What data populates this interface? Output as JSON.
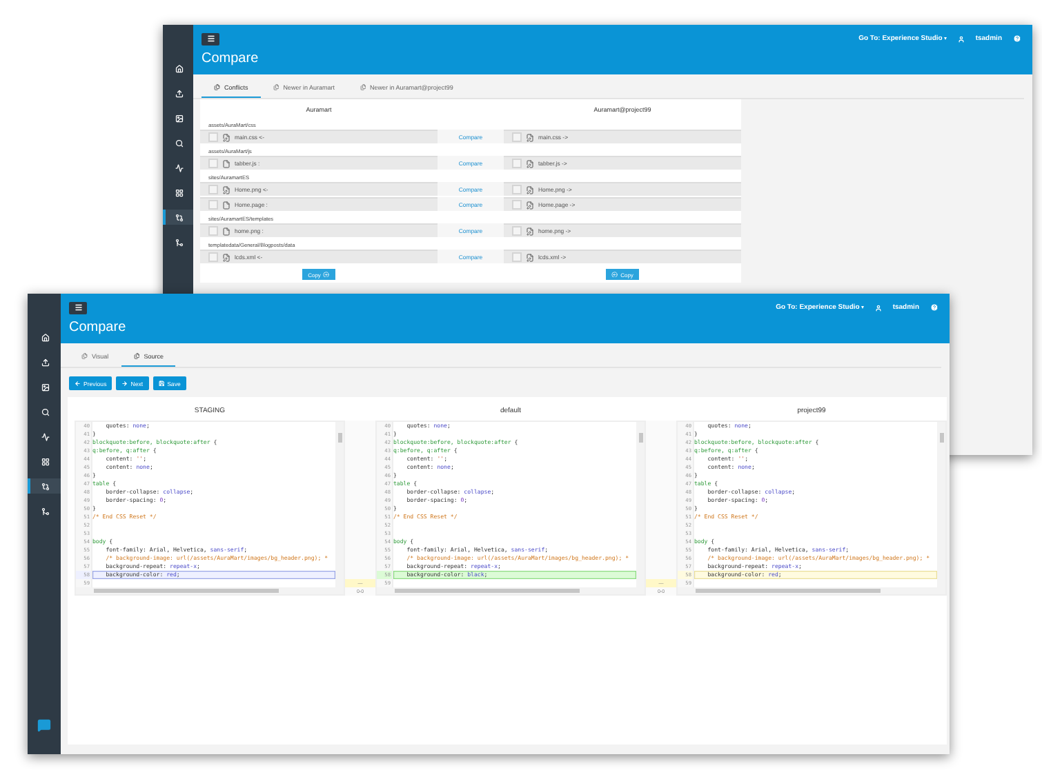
{
  "back_window": {
    "sidebar": [
      {
        "kind": "home",
        "selected": false
      },
      {
        "kind": "upload",
        "selected": false
      },
      {
        "kind": "image",
        "selected": false
      },
      {
        "kind": "search",
        "selected": false
      },
      {
        "kind": "activity",
        "selected": false
      },
      {
        "kind": "grid",
        "selected": false
      },
      {
        "kind": "compare",
        "selected": true
      },
      {
        "kind": "merge",
        "selected": false
      }
    ],
    "goto": "Go To: Experience Studio",
    "user": "tsadmin",
    "title": "Compare",
    "tabs": [
      {
        "label": "Conflicts",
        "selected": true
      },
      {
        "label": "Newer in Auramart",
        "selected": false
      },
      {
        "label": "Newer in Auramart@project99",
        "selected": false
      }
    ],
    "columns": [
      "Auramart",
      "Auramart@project99"
    ],
    "groups": [
      {
        "path": "assets/AuraMart/css",
        "rows": [
          {
            "left": {
              "name": "main.css <-",
              "kind": "edit",
              "checked": false
            },
            "link": "Compare",
            "right": {
              "name": "main.css ->",
              "kind": "edit",
              "checked": false
            }
          }
        ]
      },
      {
        "path": "assets/AuraMart/js",
        "rows": [
          {
            "left": {
              "name": "tabber.js :",
              "kind": "file",
              "checked": false
            },
            "link": "Compare",
            "right": {
              "name": "tabber.js ->",
              "kind": "edit",
              "checked": false
            }
          }
        ]
      },
      {
        "path": "sites/AuramartES",
        "rows": [
          {
            "left": {
              "name": "Home.png <-",
              "kind": "edit",
              "checked": false
            },
            "link": "Compare",
            "right": {
              "name": "Home.png ->",
              "kind": "edit",
              "checked": false
            }
          },
          {
            "left": {
              "name": "Home.page :",
              "kind": "file",
              "checked": false
            },
            "link": "Compare",
            "right": {
              "name": "Home.page ->",
              "kind": "edit",
              "checked": false
            }
          }
        ]
      },
      {
        "path": "sites/AuramartES/templates",
        "rows": [
          {
            "left": {
              "name": "home.png :",
              "kind": "file",
              "checked": false
            },
            "link": "Compare",
            "right": {
              "name": "home.png ->",
              "kind": "edit",
              "checked": false
            }
          }
        ]
      },
      {
        "path": "templatedata/General/Blogposts/data",
        "rows": [
          {
            "left": {
              "name": "lcds.xml <-",
              "kind": "edit",
              "checked": false
            },
            "link": "Compare",
            "right": {
              "name": "lcds.xml ->",
              "kind": "edit",
              "checked": false
            }
          }
        ]
      }
    ],
    "copy_buttons": [
      {
        "label": "Copy",
        "kind": "right"
      },
      {
        "label": "Copy",
        "kind": "left"
      }
    ]
  },
  "front_window": {
    "sidebar": [
      {
        "kind": "home",
        "selected": false
      },
      {
        "kind": "upload",
        "selected": false
      },
      {
        "kind": "image",
        "selected": false
      },
      {
        "kind": "search",
        "selected": false
      },
      {
        "kind": "activity",
        "selected": false
      },
      {
        "kind": "grid",
        "selected": false
      },
      {
        "kind": "compare",
        "selected": true
      },
      {
        "kind": "merge",
        "selected": false
      }
    ],
    "goto": "Go To: Experience Studio",
    "user": "tsadmin",
    "title": "Compare",
    "tabs": [
      {
        "label": "Visual",
        "selected": false
      },
      {
        "label": "Source",
        "selected": true
      }
    ],
    "buttons": [
      {
        "label": "Previous",
        "kind": "previous"
      },
      {
        "label": "Next",
        "kind": "next"
      },
      {
        "label": "Save",
        "kind": "save"
      }
    ],
    "panes": [
      {
        "title": "STAGING",
        "lines": [
          {
            "n": "40",
            "parts": [
              {
                "kind": "plain",
                "text": "    quotes: "
              },
              {
                "kind": "val",
                "text": "none"
              },
              {
                "kind": "plain",
                "text": ";"
              }
            ]
          },
          {
            "n": "41",
            "parts": [
              {
                "kind": "plain",
                "text": "}"
              }
            ]
          },
          {
            "n": "42",
            "parts": [
              {
                "kind": "sel",
                "text": "blockquote:before, blockquote:after"
              },
              {
                "kind": "plain",
                "text": " {"
              }
            ]
          },
          {
            "n": "43",
            "parts": [
              {
                "kind": "sel",
                "text": "q:before, q:after"
              },
              {
                "kind": "plain",
                "text": " {"
              }
            ]
          },
          {
            "n": "44",
            "parts": [
              {
                "kind": "plain",
                "text": "    content: "
              },
              {
                "kind": "str",
                "text": "''"
              },
              {
                "kind": "plain",
                "text": ";"
              }
            ]
          },
          {
            "n": "45",
            "parts": [
              {
                "kind": "plain",
                "text": "    content: "
              },
              {
                "kind": "val",
                "text": "none"
              },
              {
                "kind": "plain",
                "text": ";"
              }
            ]
          },
          {
            "n": "46",
            "parts": [
              {
                "kind": "plain",
                "text": "}"
              }
            ]
          },
          {
            "n": "47",
            "parts": [
              {
                "kind": "sel",
                "text": "table"
              },
              {
                "kind": "plain",
                "text": " {"
              }
            ]
          },
          {
            "n": "48",
            "parts": [
              {
                "kind": "plain",
                "text": "    border-collapse: "
              },
              {
                "kind": "val",
                "text": "collapse"
              },
              {
                "kind": "plain",
                "text": ";"
              }
            ]
          },
          {
            "n": "49",
            "parts": [
              {
                "kind": "plain",
                "text": "    border-spacing: "
              },
              {
                "kind": "num",
                "text": "0"
              },
              {
                "kind": "plain",
                "text": ";"
              }
            ]
          },
          {
            "n": "50",
            "parts": [
              {
                "kind": "plain",
                "text": "}"
              }
            ]
          },
          {
            "n": "51",
            "parts": [
              {
                "kind": "com",
                "text": "/* End CSS Reset */"
              }
            ]
          },
          {
            "n": "52"
          },
          {
            "n": "53"
          },
          {
            "n": "54",
            "parts": [
              {
                "kind": "sel",
                "text": "body"
              },
              {
                "kind": "plain",
                "text": " {"
              }
            ]
          },
          {
            "n": "55",
            "parts": [
              {
                "kind": "plain",
                "text": "    font-family: Arial, Helvetica, "
              },
              {
                "kind": "val",
                "text": "sans-serif"
              },
              {
                "kind": "plain",
                "text": ";"
              }
            ]
          },
          {
            "n": "56",
            "parts": [
              {
                "kind": "com",
                "text": "    /* background-image: url(/assets/AuraMart/images/bg_header.png); *"
              }
            ]
          },
          {
            "n": "57",
            "parts": [
              {
                "kind": "plain",
                "text": "    background-repeat: "
              },
              {
                "kind": "val",
                "text": "repeat-x"
              },
              {
                "kind": "plain",
                "text": ";"
              }
            ]
          },
          {
            "n": "58",
            "kind": "changed",
            "parts": [
              {
                "kind": "plain",
                "text": "    background-color: "
              },
              {
                "kind": "val",
                "text": "red"
              },
              {
                "kind": "plain",
                "text": ";"
              }
            ]
          },
          {
            "n": "59"
          }
        ]
      },
      {
        "title": "default",
        "lines": [
          {
            "n": "40",
            "parts": [
              {
                "kind": "plain",
                "text": "    quotes: "
              },
              {
                "kind": "val",
                "text": "none"
              },
              {
                "kind": "plain",
                "text": ";"
              }
            ]
          },
          {
            "n": "41",
            "parts": [
              {
                "kind": "plain",
                "text": "}"
              }
            ]
          },
          {
            "n": "42",
            "parts": [
              {
                "kind": "sel",
                "text": "blockquote:before, blockquote:after"
              },
              {
                "kind": "plain",
                "text": " {"
              }
            ]
          },
          {
            "n": "43",
            "parts": [
              {
                "kind": "sel",
                "text": "q:before, q:after"
              },
              {
                "kind": "plain",
                "text": " {"
              }
            ]
          },
          {
            "n": "44",
            "parts": [
              {
                "kind": "plain",
                "text": "    content: "
              },
              {
                "kind": "str",
                "text": "''"
              },
              {
                "kind": "plain",
                "text": ";"
              }
            ]
          },
          {
            "n": "45",
            "parts": [
              {
                "kind": "plain",
                "text": "    content: "
              },
              {
                "kind": "val",
                "text": "none"
              },
              {
                "kind": "plain",
                "text": ";"
              }
            ]
          },
          {
            "n": "46",
            "parts": [
              {
                "kind": "plain",
                "text": "}"
              }
            ]
          },
          {
            "n": "47",
            "parts": [
              {
                "kind": "sel",
                "text": "table"
              },
              {
                "kind": "plain",
                "text": " {"
              }
            ]
          },
          {
            "n": "48",
            "parts": [
              {
                "kind": "plain",
                "text": "    border-collapse: "
              },
              {
                "kind": "val",
                "text": "collapse"
              },
              {
                "kind": "plain",
                "text": ";"
              }
            ]
          },
          {
            "n": "49",
            "parts": [
              {
                "kind": "plain",
                "text": "    border-spacing: "
              },
              {
                "kind": "num",
                "text": "0"
              },
              {
                "kind": "plain",
                "text": ";"
              }
            ]
          },
          {
            "n": "50",
            "parts": [
              {
                "kind": "plain",
                "text": "}"
              }
            ]
          },
          {
            "n": "51",
            "parts": [
              {
                "kind": "com",
                "text": "/* End CSS Reset */"
              }
            ]
          },
          {
            "n": "52"
          },
          {
            "n": "53"
          },
          {
            "n": "54",
            "parts": [
              {
                "kind": "sel",
                "text": "body"
              },
              {
                "kind": "plain",
                "text": " {"
              }
            ]
          },
          {
            "n": "55",
            "parts": [
              {
                "kind": "plain",
                "text": "    font-family: Arial, Helvetica, "
              },
              {
                "kind": "val",
                "text": "sans-serif"
              },
              {
                "kind": "plain",
                "text": ";"
              }
            ]
          },
          {
            "n": "56",
            "parts": [
              {
                "kind": "com",
                "text": "    /* background-image: url(/assets/AuraMart/images/bg_header.png); *"
              }
            ]
          },
          {
            "n": "57",
            "parts": [
              {
                "kind": "plain",
                "text": "    background-repeat: "
              },
              {
                "kind": "val",
                "text": "repeat-x"
              },
              {
                "kind": "plain",
                "text": ";"
              }
            ]
          },
          {
            "n": "58",
            "kind": "added",
            "parts": [
              {
                "kind": "plain",
                "text": "    background-color: "
              },
              {
                "kind": "val",
                "text": "black"
              },
              {
                "kind": "plain",
                "text": ";"
              }
            ]
          },
          {
            "n": "59"
          }
        ]
      },
      {
        "title": "project99",
        "lines": [
          {
            "n": "40",
            "parts": [
              {
                "kind": "plain",
                "text": "    quotes: "
              },
              {
                "kind": "val",
                "text": "none"
              },
              {
                "kind": "plain",
                "text": ";"
              }
            ]
          },
          {
            "n": "41",
            "parts": [
              {
                "kind": "plain",
                "text": "}"
              }
            ]
          },
          {
            "n": "42",
            "parts": [
              {
                "kind": "sel",
                "text": "blockquote:before, blockquote:after"
              },
              {
                "kind": "plain",
                "text": " {"
              }
            ]
          },
          {
            "n": "43",
            "parts": [
              {
                "kind": "sel",
                "text": "q:before, q:after"
              },
              {
                "kind": "plain",
                "text": " {"
              }
            ]
          },
          {
            "n": "44",
            "parts": [
              {
                "kind": "plain",
                "text": "    content: "
              },
              {
                "kind": "str",
                "text": "''"
              },
              {
                "kind": "plain",
                "text": ";"
              }
            ]
          },
          {
            "n": "45",
            "parts": [
              {
                "kind": "plain",
                "text": "    content: "
              },
              {
                "kind": "val",
                "text": "none"
              },
              {
                "kind": "plain",
                "text": ";"
              }
            ]
          },
          {
            "n": "46",
            "parts": [
              {
                "kind": "plain",
                "text": "}"
              }
            ]
          },
          {
            "n": "47",
            "parts": [
              {
                "kind": "sel",
                "text": "table"
              },
              {
                "kind": "plain",
                "text": " {"
              }
            ]
          },
          {
            "n": "48",
            "parts": [
              {
                "kind": "plain",
                "text": "    border-collapse: "
              },
              {
                "kind": "val",
                "text": "collapse"
              },
              {
                "kind": "plain",
                "text": ";"
              }
            ]
          },
          {
            "n": "49",
            "parts": [
              {
                "kind": "plain",
                "text": "    border-spacing: "
              },
              {
                "kind": "num",
                "text": "0"
              },
              {
                "kind": "plain",
                "text": ";"
              }
            ]
          },
          {
            "n": "50",
            "parts": [
              {
                "kind": "plain",
                "text": "}"
              }
            ]
          },
          {
            "n": "51",
            "parts": [
              {
                "kind": "com",
                "text": "/* End CSS Reset */"
              }
            ]
          },
          {
            "n": "52"
          },
          {
            "n": "53"
          },
          {
            "n": "54",
            "parts": [
              {
                "kind": "sel",
                "text": "body"
              },
              {
                "kind": "plain",
                "text": " {"
              }
            ]
          },
          {
            "n": "55",
            "parts": [
              {
                "kind": "plain",
                "text": "    font-family: Arial, Helvetica, "
              },
              {
                "kind": "val",
                "text": "sans-serif"
              },
              {
                "kind": "plain",
                "text": ";"
              }
            ]
          },
          {
            "n": "56",
            "parts": [
              {
                "kind": "com",
                "text": "    /* background-image: url(/assets/AuraMart/images/bg_header.png); *"
              }
            ]
          },
          {
            "n": "57",
            "parts": [
              {
                "kind": "plain",
                "text": "    background-repeat: "
              },
              {
                "kind": "val",
                "text": "repeat-x"
              },
              {
                "kind": "plain",
                "text": ";"
              }
            ]
          },
          {
            "n": "58",
            "kind": "modified",
            "parts": [
              {
                "kind": "plain",
                "text": "    background-color: "
              },
              {
                "kind": "val",
                "text": "red"
              },
              {
                "kind": "plain",
                "text": ";"
              }
            ]
          },
          {
            "n": "59"
          }
        ]
      }
    ],
    "gutters": [
      {
        "mark": "—",
        "range": "0-0"
      },
      {
        "mark": "—",
        "range": "0-0"
      }
    ]
  }
}
